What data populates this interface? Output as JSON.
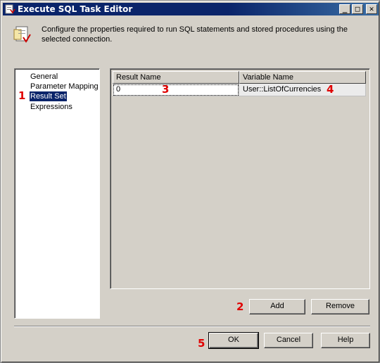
{
  "window": {
    "title": "Execute SQL Task Editor"
  },
  "title_buttons": {
    "minimize": "_",
    "maximize": "□",
    "close": "✕"
  },
  "header": {
    "description": "Configure the properties required to run SQL statements and stored procedures using the selected connection."
  },
  "nav": {
    "items": [
      {
        "label": "General"
      },
      {
        "label": "Parameter Mapping"
      },
      {
        "label": "Result Set"
      },
      {
        "label": "Expressions"
      }
    ],
    "selected": "Result Set"
  },
  "grid": {
    "columns": [
      "Result Name",
      "Variable Name"
    ],
    "rows": [
      {
        "result_name": "0",
        "variable_name": "User::ListOfCurrencies"
      }
    ]
  },
  "buttons": {
    "add": "Add",
    "remove": "Remove",
    "ok": "OK",
    "cancel": "Cancel",
    "help": "Help"
  },
  "annotations": {
    "a1": "1",
    "a2": "2",
    "a3": "3",
    "a4": "4",
    "a5": "5"
  },
  "icons": {
    "app": "sql-task-icon",
    "header": "task-document-icon"
  },
  "colors": {
    "titlebar": "#0a246a",
    "selection": "#0a246a",
    "annotation": "#e00000",
    "face": "#d4d0c8"
  }
}
